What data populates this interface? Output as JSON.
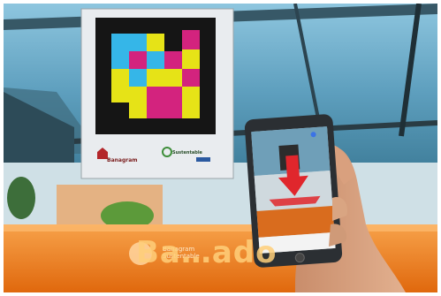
{
  "photo": {
    "storefront_text": "Ba…ado",
    "storefront_small": "Banagram Sustentable",
    "sign_left_logo": "Banagram",
    "sign_right_logo": "Sustentable"
  },
  "colors": {
    "sky": "#6fa8c4",
    "marker_cyan": "#35b6e8",
    "marker_magenta": "#d3237e",
    "marker_yellow": "#e6e317",
    "storefront_orange": "#f08a1a",
    "phone_arrow_red": "#e0262c"
  }
}
